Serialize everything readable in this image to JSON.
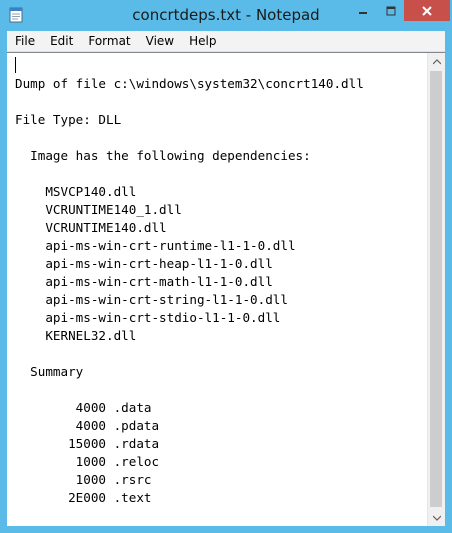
{
  "window": {
    "title": "concrtdeps.txt - Notepad",
    "accent_color": "#5bbbe8",
    "close_color": "#c7504a"
  },
  "titlebar_icons": {
    "app": "notepad-icon",
    "minimize": "minimize-icon",
    "maximize": "maximize-icon",
    "close": "close-icon"
  },
  "menu": {
    "items": [
      "File",
      "Edit",
      "Format",
      "View",
      "Help"
    ]
  },
  "document": {
    "text": "\nDump of file c:\\windows\\system32\\concrt140.dll\n\nFile Type: DLL\n\n  Image has the following dependencies:\n\n    MSVCP140.dll\n    VCRUNTIME140_1.dll\n    VCRUNTIME140.dll\n    api-ms-win-crt-runtime-l1-1-0.dll\n    api-ms-win-crt-heap-l1-1-0.dll\n    api-ms-win-crt-math-l1-1-0.dll\n    api-ms-win-crt-string-l1-1-0.dll\n    api-ms-win-crt-stdio-l1-1-0.dll\n    KERNEL32.dll\n\n  Summary\n\n        4000 .data\n        4000 .pdata\n       15000 .rdata\n        1000 .reloc\n        1000 .rsrc\n       2E000 .text"
  },
  "scrollbar": {
    "up_icon": "scroll-up-arrow-icon",
    "down_icon": "scroll-down-arrow-icon"
  }
}
